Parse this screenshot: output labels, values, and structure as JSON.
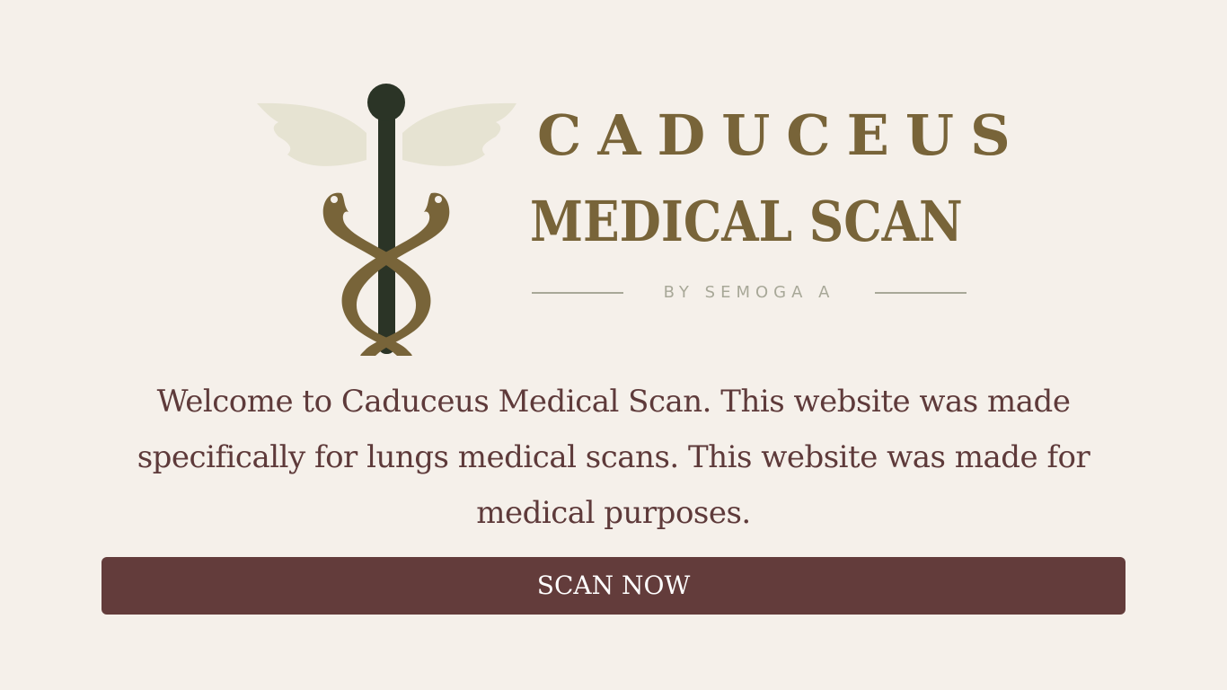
{
  "logo": {
    "line1": "CADUCEUS",
    "line2": "MEDICAL SCAN",
    "byline": "BY SEMOGA A",
    "icon": "caduceus-icon"
  },
  "intro": {
    "text": "Welcome to Caduceus Medical Scan. This website was made specifically for lungs medical scans. This website was made for medical purposes."
  },
  "cta": {
    "label": "SCAN NOW"
  },
  "colors": {
    "background": "#f5f0ea",
    "brand": "#786439",
    "staff": "#2b3426",
    "wings": "#e6e3d2",
    "text": "#5e3a3a",
    "button": "#633c3b"
  }
}
